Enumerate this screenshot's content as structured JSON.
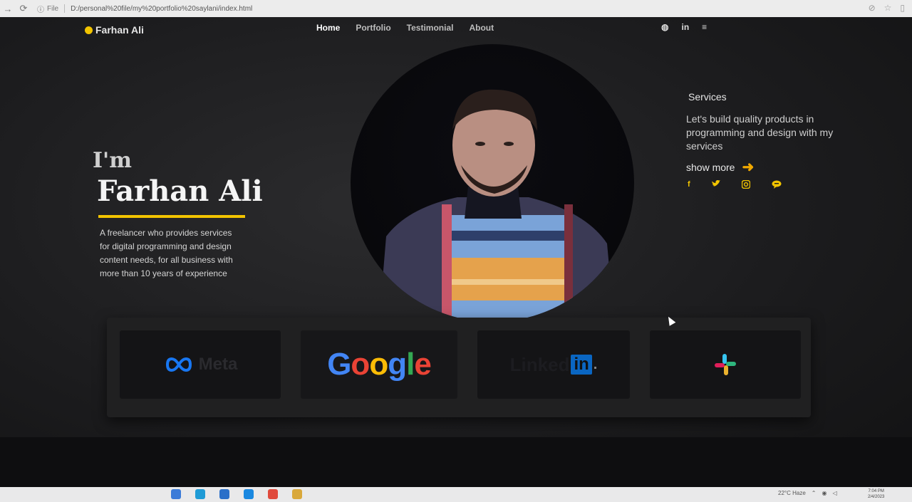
{
  "browser": {
    "back_icon": "arrow-right-icon",
    "reload_icon": "reload-icon",
    "info_icon": "info-icon",
    "file_label": "File",
    "url": "D:/personal%20file/my%20portfolio%20saylani/index.html"
  },
  "site": {
    "logo_text": "Farhan Ali",
    "accent_color": "#f2c400",
    "nav": [
      {
        "label": "Home",
        "active": true
      },
      {
        "label": "Portfolio",
        "active": false
      },
      {
        "label": "Testimonial",
        "active": false
      },
      {
        "label": "About",
        "active": false
      }
    ],
    "header_icons": [
      "dribbble-icon",
      "linkedin-icon",
      "menu-icon"
    ],
    "header_icon_glyphs": [
      "◍",
      "in",
      "≡"
    ]
  },
  "hero": {
    "intro": "I'm",
    "name": "Farhan Ali",
    "description": "A freelancer who provides services for digital programming and design content needs, for all business with more than 10 years of experience"
  },
  "services": {
    "title": "Services",
    "text": "Let's build quality products in programming and design with my services",
    "show_more": "show more",
    "socials": [
      {
        "name": "facebook-icon",
        "glyph": "f"
      },
      {
        "name": "twitter-icon",
        "glyph": "🐦"
      },
      {
        "name": "instagram-icon",
        "glyph": "◘"
      },
      {
        "name": "chat-icon",
        "glyph": "💬"
      }
    ]
  },
  "brands": {
    "meta": "Meta",
    "google": "Google",
    "linkedin_word": "Linked",
    "linkedin_badge": "in",
    "slack": "slack"
  },
  "taskbar": {
    "weather": "22°C Haze",
    "time": "7:04 PM",
    "date": "2/4/2023"
  }
}
